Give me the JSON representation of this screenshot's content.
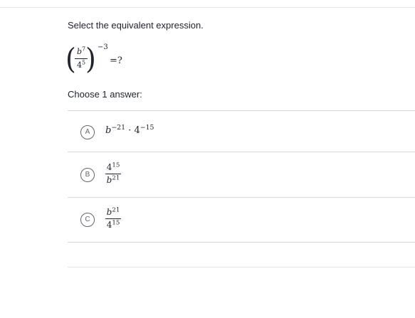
{
  "question": {
    "prompt": "Select the equivalent expression.",
    "expression": {
      "numerator_base": "b",
      "numerator_exp": "7",
      "denominator_base": "4",
      "denominator_exp": "5",
      "outer_exp": "−3",
      "tail": "=?"
    }
  },
  "answers": {
    "instruction": "Choose 1 answer:",
    "choices": [
      {
        "letter": "A",
        "expr": {
          "base1": "b",
          "exp1": "−21",
          "dot": "·",
          "base2": "4",
          "exp2": "−15"
        }
      },
      {
        "letter": "B",
        "expr": {
          "num_base": "4",
          "num_exp": "15",
          "den_base": "b",
          "den_exp": "21"
        }
      },
      {
        "letter": "C",
        "expr": {
          "num_base": "b",
          "num_exp": "21",
          "den_base": "4",
          "den_exp": "15"
        }
      }
    ]
  }
}
